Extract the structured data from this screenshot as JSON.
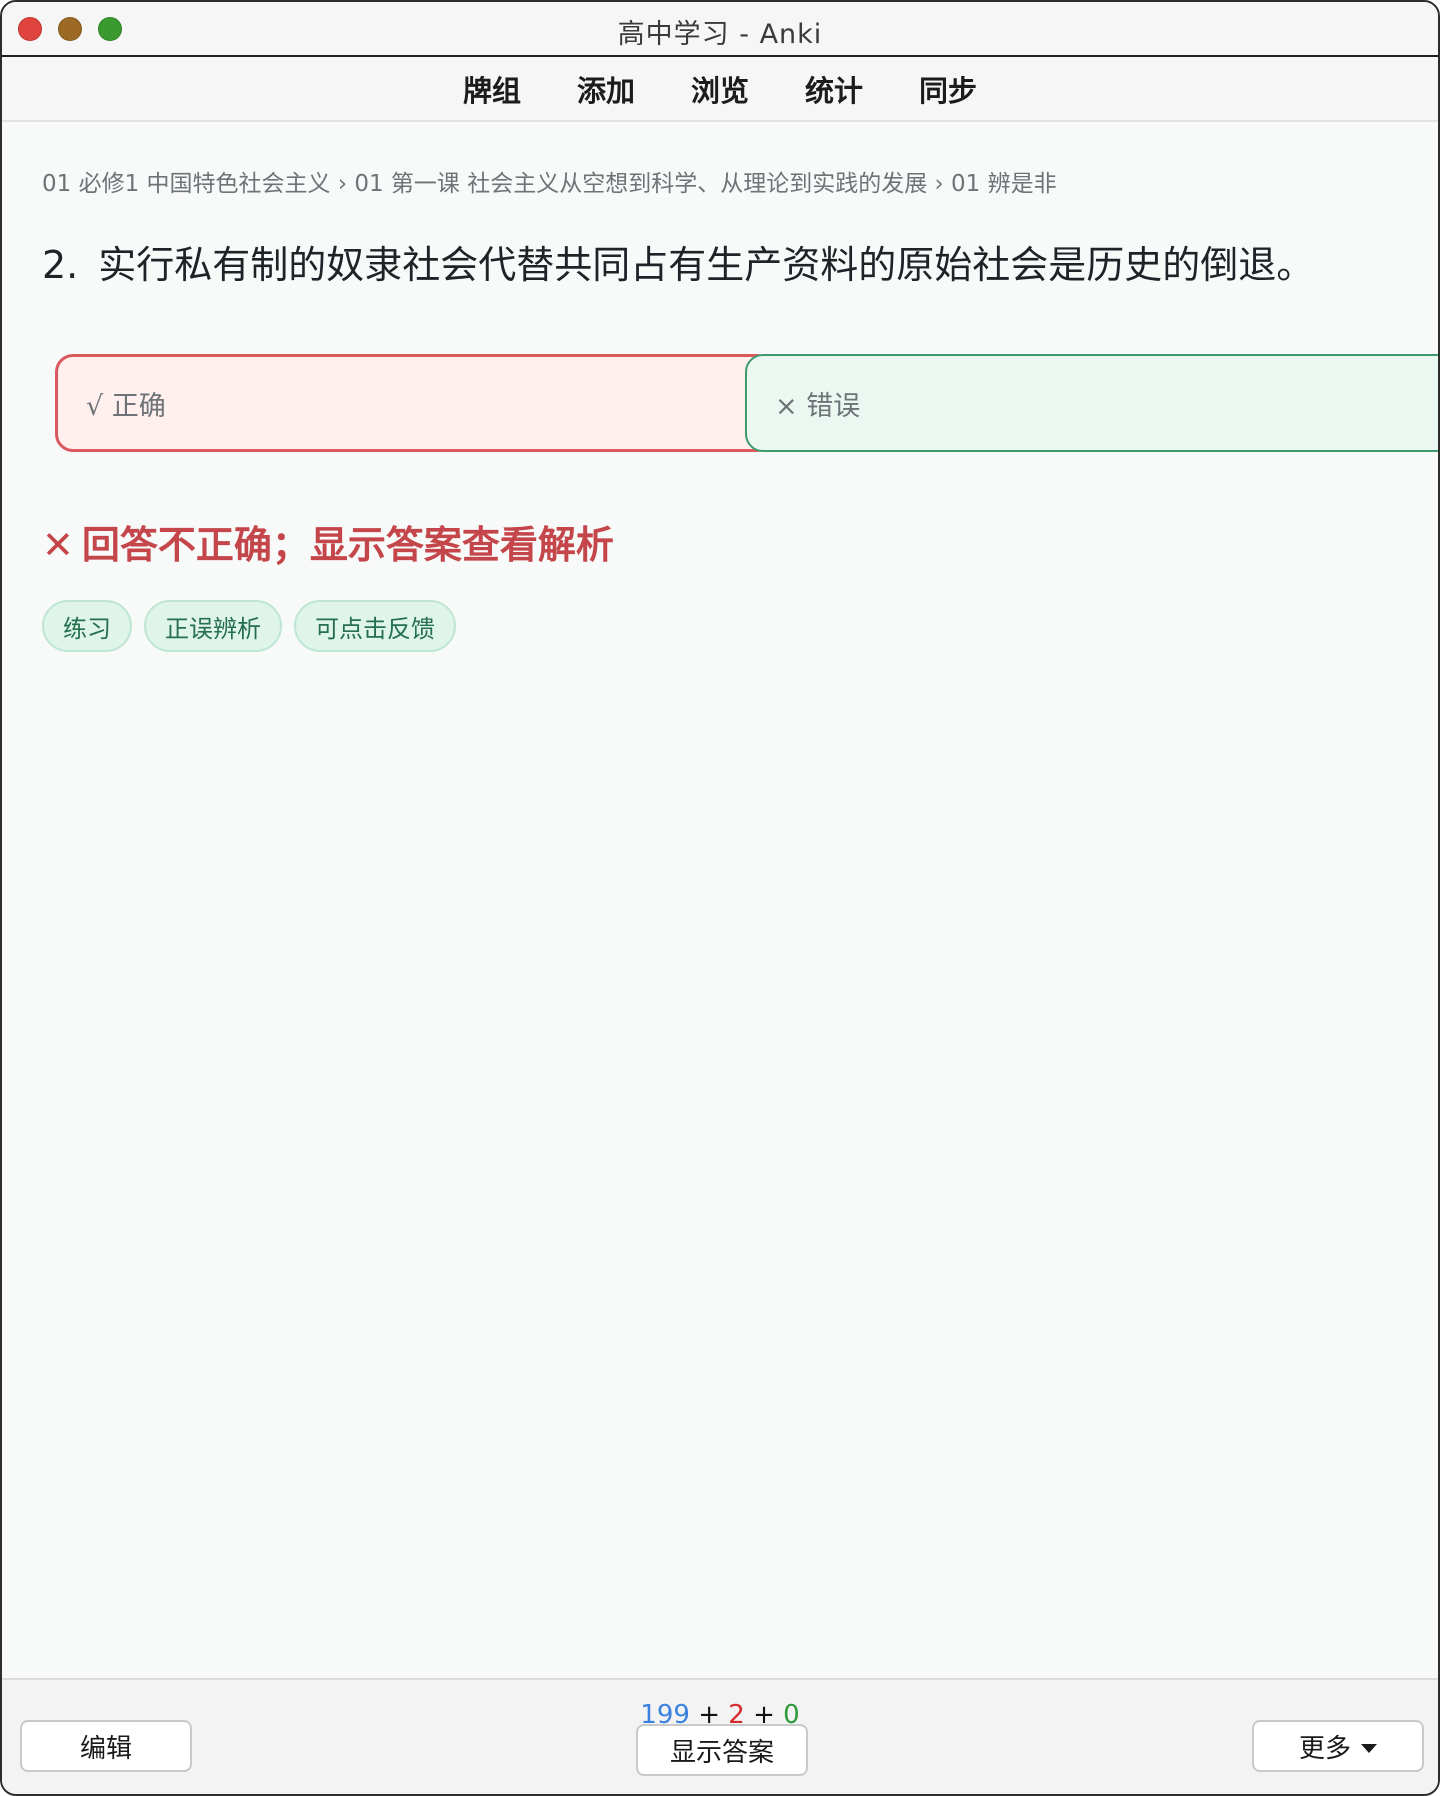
{
  "window": {
    "title": "高中学习 - Anki"
  },
  "nav": {
    "items": [
      "牌组",
      "添加",
      "浏览",
      "统计",
      "同步"
    ]
  },
  "card": {
    "breadcrumb": "01 必修1 中国特色社会主义 › 01 第一课 社会主义从空想到科学、从理论到实践的发展 › 01 辨是非",
    "question_number": "2.",
    "question_text": "实行私有制的奴隶社会代替共同占有生产资料的原始社会是历史的倒退。",
    "options": [
      {
        "label": "√ 正确",
        "state": "selected-incorrect"
      },
      {
        "label": "× 错误",
        "state": "correct-answer"
      }
    ],
    "feedback_icon": "✕",
    "feedback_text": "回答不正确；显示答案查看解析",
    "tags": [
      "练习",
      "正误辨析",
      "可点击反馈"
    ]
  },
  "bottom": {
    "counts": {
      "new": "199",
      "sep1": "+",
      "learn": "2",
      "sep2": "+",
      "review": "0"
    },
    "edit_label": "编辑",
    "show_answer_label": "显示答案",
    "more_label": "更多"
  },
  "colors": {
    "incorrect_red": "#c4464a",
    "correct_green": "#3f9a6e",
    "new_count_blue": "#3b82e0",
    "learn_count_red": "#d42a2a",
    "review_count_green": "#2e9a3a"
  }
}
